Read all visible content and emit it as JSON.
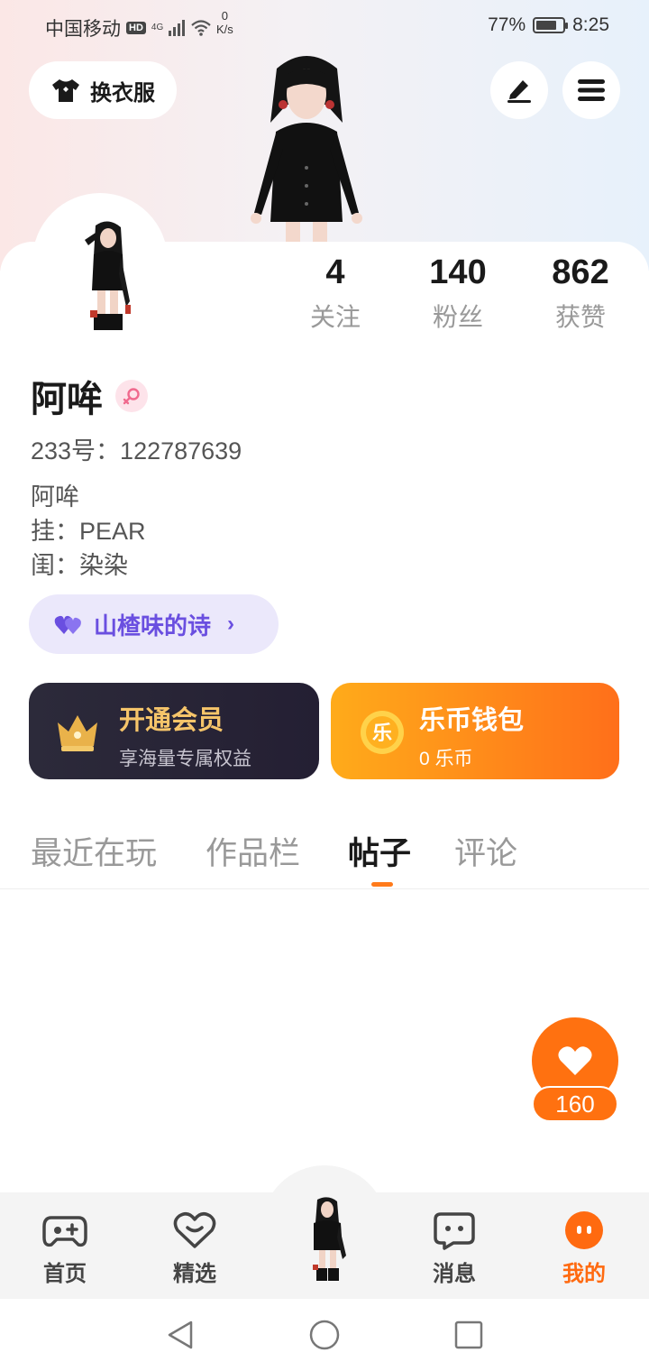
{
  "status_bar": {
    "carrier": "中国移动",
    "hd": "HD",
    "network": "4G",
    "speed_value": "0",
    "speed_unit": "K/s",
    "battery": "77%",
    "time": "8:25"
  },
  "top": {
    "outfit_label": "换衣服"
  },
  "stats": [
    {
      "value": "4",
      "label": "关注"
    },
    {
      "value": "140",
      "label": "粉丝"
    },
    {
      "value": "862",
      "label": "获赞"
    }
  ],
  "profile": {
    "name": "阿哞",
    "uid": "233号：122787639",
    "bio_lines": [
      "阿哞",
      "挂：PEAR",
      "闺：染染"
    ]
  },
  "signature": {
    "label": "山楂味的诗"
  },
  "vip_card": {
    "title": "开通会员",
    "subtitle": "享海量专属权益"
  },
  "coin_card": {
    "title": "乐币钱包",
    "subtitle": "0 乐币",
    "icon_char": "乐"
  },
  "tabs": [
    {
      "label": "最近在玩"
    },
    {
      "label": "作品栏"
    },
    {
      "label": "帖子",
      "active": true
    },
    {
      "label": "评论"
    }
  ],
  "like_fab": {
    "count": "160"
  },
  "bottom_nav": [
    {
      "label": "首页",
      "icon": "gamepad-icon"
    },
    {
      "label": "精选",
      "icon": "heart-chat-icon"
    },
    {
      "label": "",
      "icon": "avatar-center-icon"
    },
    {
      "label": "消息",
      "icon": "message-icon"
    },
    {
      "label": "我的",
      "icon": "me-icon",
      "active": true
    }
  ],
  "colors": {
    "accent": "#ff7110",
    "purple": "#6a4fe0",
    "gold": "#f6c56a"
  }
}
